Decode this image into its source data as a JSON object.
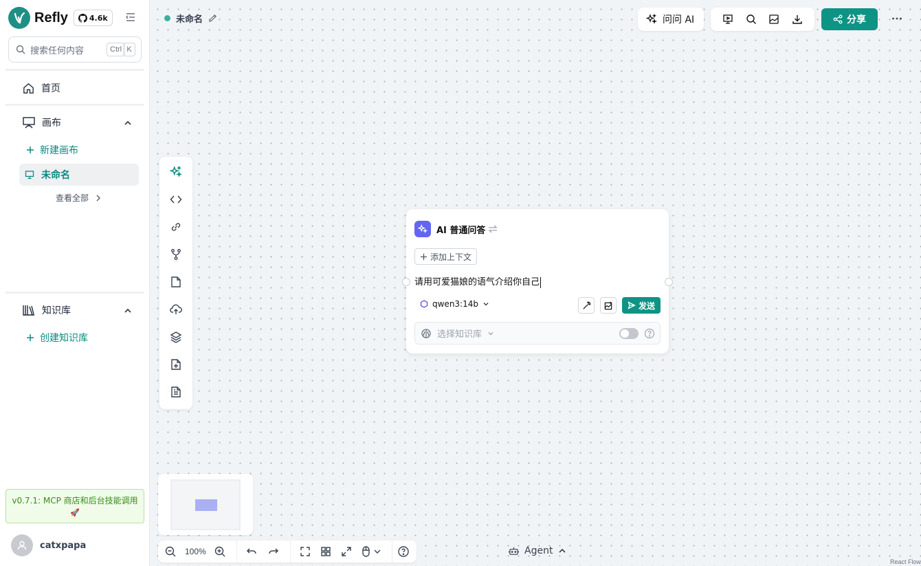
{
  "app": {
    "name": "Refly",
    "github_stars": "4.6k",
    "brand_color": "#1f8f86"
  },
  "search": {
    "placeholder": "搜索任何内容",
    "shortcut_ctrl": "Ctrl",
    "shortcut_key": "K"
  },
  "sidebar": {
    "home_label": "首页",
    "canvas_section_label": "画布",
    "new_canvas_label": "新建画布",
    "active_canvas_label": "未命名",
    "view_all_label": "查看全部",
    "knowledge_section_label": "知识库",
    "create_kb_label": "创建知识库",
    "version_notice": "v0.7.1: MCP 商店和后台技能调用",
    "version_emoji": "🚀",
    "username": "catxpapa"
  },
  "topbar": {
    "doc_title": "未命名",
    "ask_ai_label": "问问 AI",
    "share_label": "分享",
    "accent_color": "#0e9384"
  },
  "node": {
    "title": "AI 普通问答",
    "add_context_label": "添加上下文",
    "prompt_text": "请用可爱猫娘的语气介绍你自己",
    "model_name": "qwen3:14b",
    "send_label": "发送",
    "kb_placeholder": "选择知识库"
  },
  "bottom": {
    "zoom_level": "100%",
    "agent_label": "Agent",
    "credit": "React Flow"
  },
  "icons": {
    "sidebar": [
      "github-icon",
      "collapse-sidebar-icon",
      "search-icon",
      "home-icon",
      "canvas-icon",
      "chevron-up-icon",
      "plus-icon",
      "monitor-icon",
      "chevron-right-icon",
      "library-icon",
      "user-icon"
    ],
    "topbar": [
      "edit-icon",
      "sparkles-icon",
      "presentation-icon",
      "search-icon",
      "image-icon",
      "download-icon",
      "share-icon",
      "more-icon"
    ],
    "tools": [
      "sparkles-icon",
      "code-icon",
      "link-icon",
      "branch-icon",
      "document-icon",
      "upload-cloud-icon",
      "layers-icon",
      "file-plus-icon",
      "file-text-icon"
    ]
  }
}
